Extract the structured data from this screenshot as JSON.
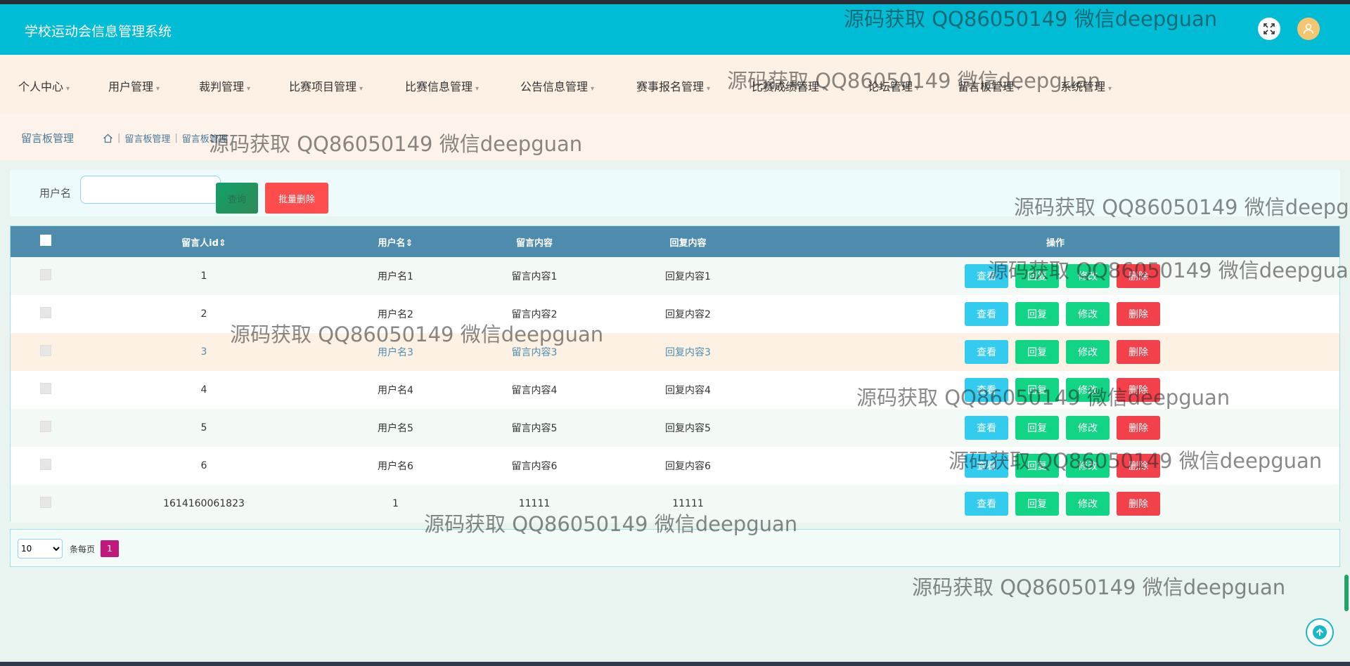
{
  "app": {
    "title": "学校运动会信息管理系统"
  },
  "nav": [
    {
      "label": "个人中心"
    },
    {
      "label": "用户管理"
    },
    {
      "label": "裁判管理"
    },
    {
      "label": "比赛项目管理"
    },
    {
      "label": "比赛信息管理"
    },
    {
      "label": "公告信息管理"
    },
    {
      "label": "赛事报名管理"
    },
    {
      "label": "比赛成绩管理"
    },
    {
      "label": "论坛管理"
    },
    {
      "label": "留言板管理"
    },
    {
      "label": "系统管理"
    }
  ],
  "breadcrumb": {
    "page_title": "留言板管理",
    "level1": "留言板管理",
    "level2": "留言板管理"
  },
  "search": {
    "label": "用户名",
    "value": "",
    "placeholder": "",
    "query_label": "查询",
    "batch_delete_label": "批量删除"
  },
  "table": {
    "columns": [
      "留言人id⇕",
      "用户名⇕",
      "留言内容",
      "回复内容",
      "操作"
    ],
    "actions": {
      "view": "查看",
      "reply": "回复",
      "edit": "修改",
      "delete": "删除"
    },
    "rows": [
      {
        "id": "1",
        "user": "用户名1",
        "content": "留言内容1",
        "reply": "回复内容1"
      },
      {
        "id": "2",
        "user": "用户名2",
        "content": "留言内容2",
        "reply": "回复内容2"
      },
      {
        "id": "3",
        "user": "用户名3",
        "content": "留言内容3",
        "reply": "回复内容3"
      },
      {
        "id": "4",
        "user": "用户名4",
        "content": "留言内容4",
        "reply": "回复内容4"
      },
      {
        "id": "5",
        "user": "用户名5",
        "content": "留言内容5",
        "reply": "回复内容5"
      },
      {
        "id": "6",
        "user": "用户名6",
        "content": "留言内容6",
        "reply": "回复内容6"
      },
      {
        "id": "1614160061823",
        "user": "1",
        "content": "11111",
        "reply": "11111"
      }
    ]
  },
  "pagination": {
    "page_size": "10",
    "per_page_label": "条每页",
    "current_page": "1"
  },
  "watermark": "源码获取 QQ86050149 微信deepguan",
  "colors": {
    "header": "#00bcd4",
    "table_head": "#4f8bad",
    "view": "#33ccee",
    "reply": "#12d485",
    "delete": "#f2414b",
    "page_active": "#c2187c"
  }
}
